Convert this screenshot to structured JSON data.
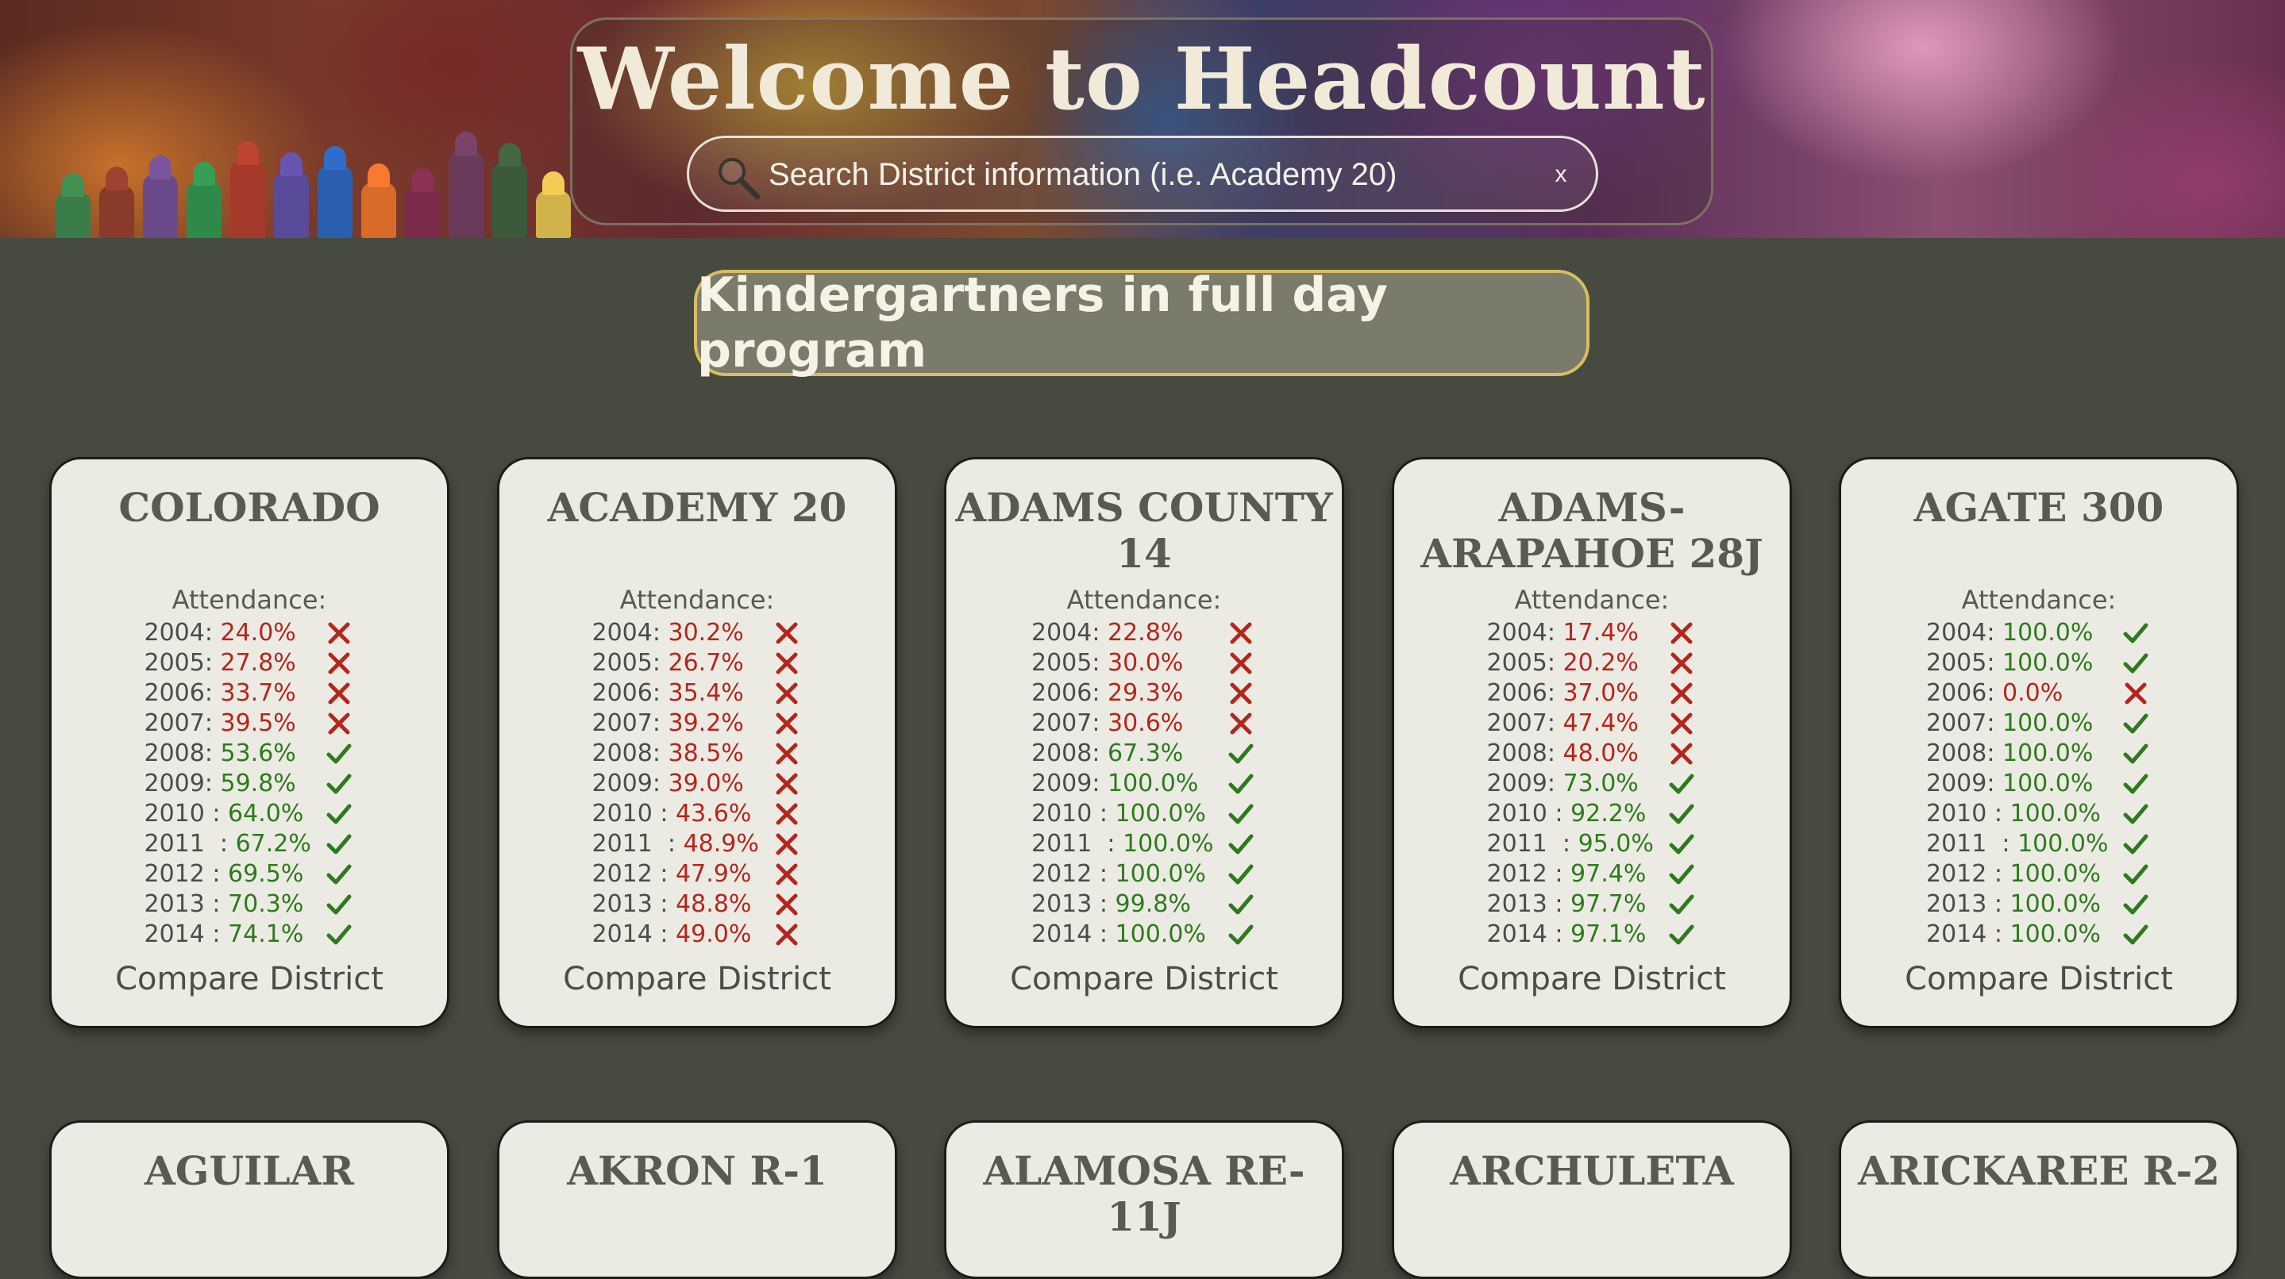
{
  "header": {
    "title": "Welcome to Headcount",
    "search_placeholder": "Search District information (i.e. Academy 20)",
    "clear_label": "x"
  },
  "category_pill": "Kindergartners in full day program",
  "cards": [
    {
      "name": "COLORADO",
      "attendance_label": "Attendance:",
      "compare_label": "Compare District",
      "rows": [
        {
          "year": "2004:",
          "value": "24.0%",
          "status": "fail"
        },
        {
          "year": "2005:",
          "value": "27.8%",
          "status": "fail"
        },
        {
          "year": "2006:",
          "value": "33.7%",
          "status": "fail"
        },
        {
          "year": "2007:",
          "value": "39.5%",
          "status": "fail"
        },
        {
          "year": "2008:",
          "value": "53.6%",
          "status": "pass"
        },
        {
          "year": "2009:",
          "value": "59.8%",
          "status": "pass"
        },
        {
          "year": "2010 :",
          "value": "64.0%",
          "status": "pass"
        },
        {
          "year": "2011  :",
          "value": "67.2%",
          "status": "pass"
        },
        {
          "year": "2012 :",
          "value": "69.5%",
          "status": "pass"
        },
        {
          "year": "2013 :",
          "value": "70.3%",
          "status": "pass"
        },
        {
          "year": "2014 :",
          "value": "74.1%",
          "status": "pass"
        }
      ]
    },
    {
      "name": "ACADEMY 20",
      "attendance_label": "Attendance:",
      "compare_label": "Compare District",
      "rows": [
        {
          "year": "2004:",
          "value": "30.2%",
          "status": "fail"
        },
        {
          "year": "2005:",
          "value": "26.7%",
          "status": "fail"
        },
        {
          "year": "2006:",
          "value": "35.4%",
          "status": "fail"
        },
        {
          "year": "2007:",
          "value": "39.2%",
          "status": "fail"
        },
        {
          "year": "2008:",
          "value": "38.5%",
          "status": "fail"
        },
        {
          "year": "2009:",
          "value": "39.0%",
          "status": "fail"
        },
        {
          "year": "2010 :",
          "value": "43.6%",
          "status": "fail"
        },
        {
          "year": "2011  :",
          "value": "48.9%",
          "status": "fail"
        },
        {
          "year": "2012 :",
          "value": "47.9%",
          "status": "fail"
        },
        {
          "year": "2013 :",
          "value": "48.8%",
          "status": "fail"
        },
        {
          "year": "2014 :",
          "value": "49.0%",
          "status": "fail"
        }
      ]
    },
    {
      "name": "ADAMS COUNTY 14",
      "attendance_label": "Attendance:",
      "compare_label": "Compare District",
      "rows": [
        {
          "year": "2004:",
          "value": "22.8%",
          "status": "fail"
        },
        {
          "year": "2005:",
          "value": "30.0%",
          "status": "fail"
        },
        {
          "year": "2006:",
          "value": "29.3%",
          "status": "fail"
        },
        {
          "year": "2007:",
          "value": "30.6%",
          "status": "fail"
        },
        {
          "year": "2008:",
          "value": "67.3%",
          "status": "pass"
        },
        {
          "year": "2009:",
          "value": "100.0%",
          "status": "pass"
        },
        {
          "year": "2010 :",
          "value": "100.0%",
          "status": "pass"
        },
        {
          "year": "2011  :",
          "value": "100.0%",
          "status": "pass"
        },
        {
          "year": "2012 :",
          "value": "100.0%",
          "status": "pass"
        },
        {
          "year": "2013 :",
          "value": "99.8%",
          "status": "pass"
        },
        {
          "year": "2014 :",
          "value": "100.0%",
          "status": "pass"
        }
      ]
    },
    {
      "name": "ADAMS-ARAPAHOE 28J",
      "attendance_label": "Attendance:",
      "compare_label": "Compare District",
      "rows": [
        {
          "year": "2004:",
          "value": "17.4%",
          "status": "fail"
        },
        {
          "year": "2005:",
          "value": "20.2%",
          "status": "fail"
        },
        {
          "year": "2006:",
          "value": "37.0%",
          "status": "fail"
        },
        {
          "year": "2007:",
          "value": "47.4%",
          "status": "fail"
        },
        {
          "year": "2008:",
          "value": "48.0%",
          "status": "fail"
        },
        {
          "year": "2009:",
          "value": "73.0%",
          "status": "pass"
        },
        {
          "year": "2010 :",
          "value": "92.2%",
          "status": "pass"
        },
        {
          "year": "2011  :",
          "value": "95.0%",
          "status": "pass"
        },
        {
          "year": "2012 :",
          "value": "97.4%",
          "status": "pass"
        },
        {
          "year": "2013 :",
          "value": "97.7%",
          "status": "pass"
        },
        {
          "year": "2014 :",
          "value": "97.1%",
          "status": "pass"
        }
      ]
    },
    {
      "name": "AGATE 300",
      "attendance_label": "Attendance:",
      "compare_label": "Compare District",
      "rows": [
        {
          "year": "2004:",
          "value": "100.0%",
          "status": "pass"
        },
        {
          "year": "2005:",
          "value": "100.0%",
          "status": "pass"
        },
        {
          "year": "2006:",
          "value": "0.0%",
          "status": "fail"
        },
        {
          "year": "2007:",
          "value": "100.0%",
          "status": "pass"
        },
        {
          "year": "2008:",
          "value": "100.0%",
          "status": "pass"
        },
        {
          "year": "2009:",
          "value": "100.0%",
          "status": "pass"
        },
        {
          "year": "2010 :",
          "value": "100.0%",
          "status": "pass"
        },
        {
          "year": "2011  :",
          "value": "100.0%",
          "status": "pass"
        },
        {
          "year": "2012 :",
          "value": "100.0%",
          "status": "pass"
        },
        {
          "year": "2013 :",
          "value": "100.0%",
          "status": "pass"
        },
        {
          "year": "2014 :",
          "value": "100.0%",
          "status": "pass"
        }
      ]
    }
  ],
  "partial_cards": [
    "AGUILAR",
    "AKRON R-1",
    "ALAMOSA RE-11J",
    "ARCHULETA",
    "ARICKAREE R-2"
  ],
  "colors": {
    "fail": "#b3261e",
    "pass": "#2e7a1d",
    "page_bg": "#464a3f",
    "card_bg": "#ecebe3",
    "pill_border": "#d9bd62"
  },
  "icons": {
    "fail": "x-mark-icon",
    "pass": "check-mark-icon",
    "search": "magnifier-icon"
  }
}
